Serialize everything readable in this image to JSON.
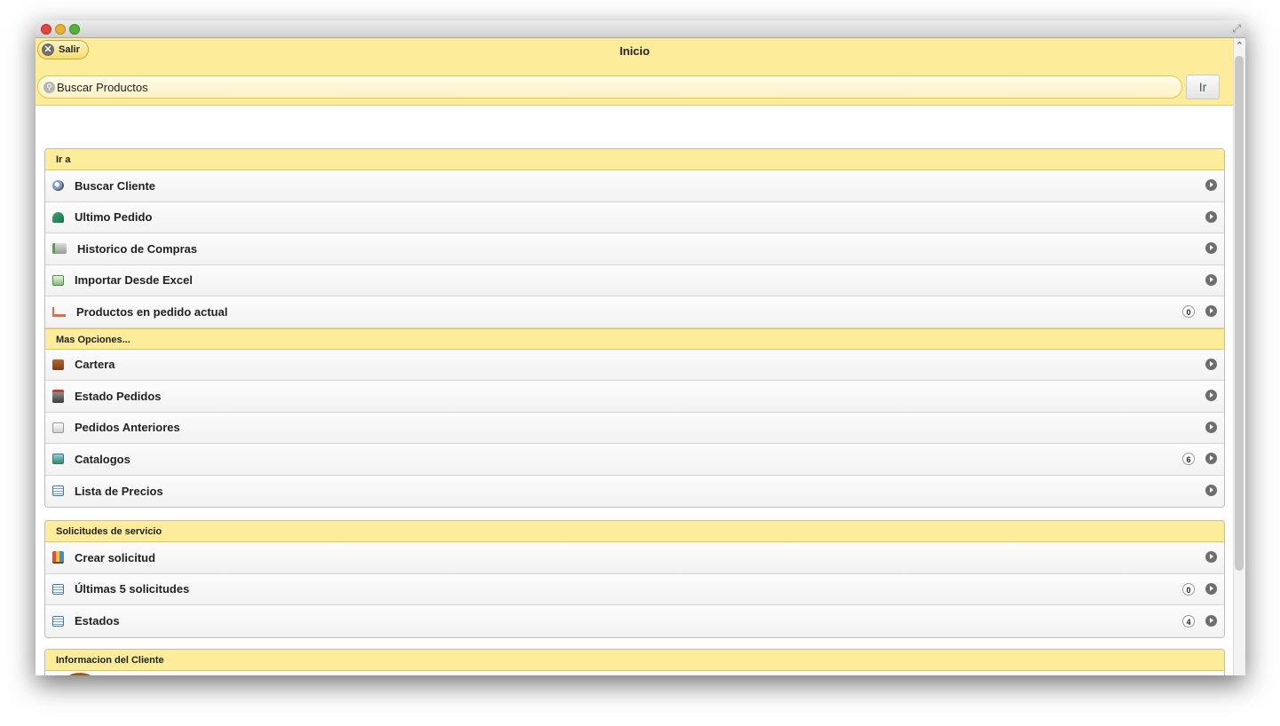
{
  "header": {
    "title": "Inicio",
    "logout_label": "Salir"
  },
  "search": {
    "placeholder": "Buscar Productos",
    "go_label": "Ir"
  },
  "groups": {
    "goto": {
      "title": "Ir a",
      "items": [
        {
          "label": "Buscar Cliente",
          "icon": "search-client-icon"
        },
        {
          "label": "Ultimo Pedido",
          "icon": "undo-icon"
        },
        {
          "label": "Historico de Compras",
          "icon": "history-icon"
        },
        {
          "label": "Importar Desde Excel",
          "icon": "excel-icon"
        },
        {
          "label": "Productos en pedido actual",
          "icon": "cart-icon",
          "count": "0"
        }
      ]
    },
    "more": {
      "title": "Mas Opciones...",
      "items": [
        {
          "label": "Cartera",
          "icon": "wallet-icon"
        },
        {
          "label": "Estado Pedidos",
          "icon": "order-status-icon"
        },
        {
          "label": "Pedidos Anteriores",
          "icon": "document-icon"
        },
        {
          "label": "Catalogos",
          "icon": "catalog-icon",
          "count": "6"
        },
        {
          "label": "Lista de Precios",
          "icon": "list-icon"
        }
      ]
    },
    "service": {
      "title": "Solicitudes de servicio",
      "items": [
        {
          "label": "Crear solicitud",
          "icon": "chart-icon"
        },
        {
          "label": "Últimas 5 solicitudes",
          "icon": "list-icon",
          "count": "0"
        },
        {
          "label": "Estados",
          "icon": "list-icon",
          "count": "4"
        }
      ]
    },
    "client": {
      "title": "Informacion del Cliente"
    }
  },
  "icons": {
    "row_chevron": "chevron-right-circle-icon",
    "logout": "close-circle-icon",
    "search": "magnifier-icon"
  },
  "colors": {
    "header_bg": "#fdec9a",
    "group_head_bg": "#fdec9a",
    "row_bg": "#f8f8f8"
  }
}
